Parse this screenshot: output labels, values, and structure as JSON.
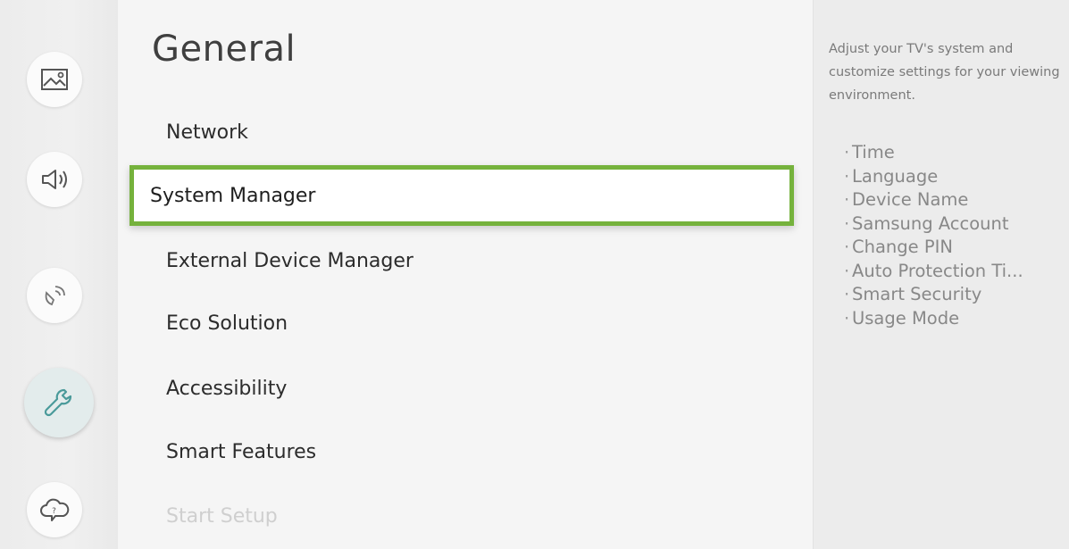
{
  "rail": {
    "items": [
      {
        "icon": "picture-icon"
      },
      {
        "icon": "sound-icon"
      },
      {
        "icon": "broadcasting-icon"
      },
      {
        "icon": "general-wrench-icon"
      },
      {
        "icon": "support-cloud-icon"
      }
    ]
  },
  "menu": {
    "title": "General",
    "items": [
      {
        "label": "Network"
      },
      {
        "label": "System Manager"
      },
      {
        "label": "External Device Manager"
      },
      {
        "label": "Eco Solution"
      },
      {
        "label": "Accessibility"
      },
      {
        "label": "Smart Features"
      },
      {
        "label": "Start Setup"
      }
    ]
  },
  "description": {
    "text": "Adjust your TV's system and customize settings for your viewing environment.",
    "bullets": [
      "Time",
      "Language",
      "Device Name",
      "Samsung Account",
      "Change PIN",
      "Auto Protection Ti...",
      "Smart Security",
      "Usage Mode"
    ]
  },
  "colors": {
    "focus_border": "#75b23c",
    "active_rail_bg": "#e3ecec"
  }
}
